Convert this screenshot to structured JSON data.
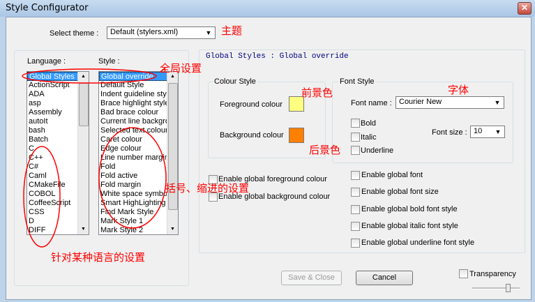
{
  "window": {
    "title": "Style Configurator",
    "close_glyph": "✕"
  },
  "theme": {
    "label": "Select theme :",
    "value": "Default (stylers.xml)"
  },
  "language": {
    "label": "Language :",
    "items": [
      "Global Styles",
      "ActionScript",
      "ADA",
      "asp",
      "Assembly",
      "autoIt",
      "bash",
      "Batch",
      "C",
      "C++",
      "C#",
      "Caml",
      "CMakeFile",
      "COBOL",
      "CoffeeScript",
      "CSS",
      "D",
      "DIFF"
    ]
  },
  "style": {
    "label": "Style :",
    "items": [
      "Global override",
      "Default Style",
      "Indent guideline style",
      "Brace highlight style",
      "Bad brace colour",
      "Current line background colour",
      "Selected text colour",
      "Caret colour",
      "Edge colour",
      "Line number margin",
      "Fold",
      "Fold active",
      "Fold margin",
      "White space symbol",
      "Smart HighLighting",
      "Find Mark Style",
      "Mark Style 1",
      "Mark Style 2"
    ]
  },
  "header": {
    "text": "Global Styles : Global override"
  },
  "colour_style": {
    "title": "Colour Style",
    "foreground_label": "Foreground colour",
    "background_label": "Background colour",
    "foreground_color": "#ffff80",
    "background_color": "#ff8000"
  },
  "font_style": {
    "title": "Font Style",
    "font_name_label": "Font name :",
    "font_name_value": "Courier New",
    "bold": "Bold",
    "italic": "Italic",
    "underline": "Underline",
    "font_size_label": "Font size :",
    "font_size_value": "10"
  },
  "global_options": {
    "fg": "Enable global foreground colour",
    "bg": "Enable global background colour",
    "font": "Enable global font",
    "size": "Enable global font size",
    "bold": "Enable global bold font style",
    "italic": "Enable global italic font style",
    "underline": "Enable global underline font style"
  },
  "buttons": {
    "save_close": "Save & Close",
    "cancel": "Cancel"
  },
  "transparency": {
    "label": "Transparency"
  },
  "annotations": {
    "theme": "主题",
    "global_settings": "全局设置",
    "foreground": "前景色",
    "font": "字体",
    "background": "后景色",
    "brace_indent": "括号、缩进的设置",
    "language_specific": "针对某种语言的设置"
  },
  "colors": {
    "annotation": "#ff0000",
    "selection": "#3399ff"
  }
}
